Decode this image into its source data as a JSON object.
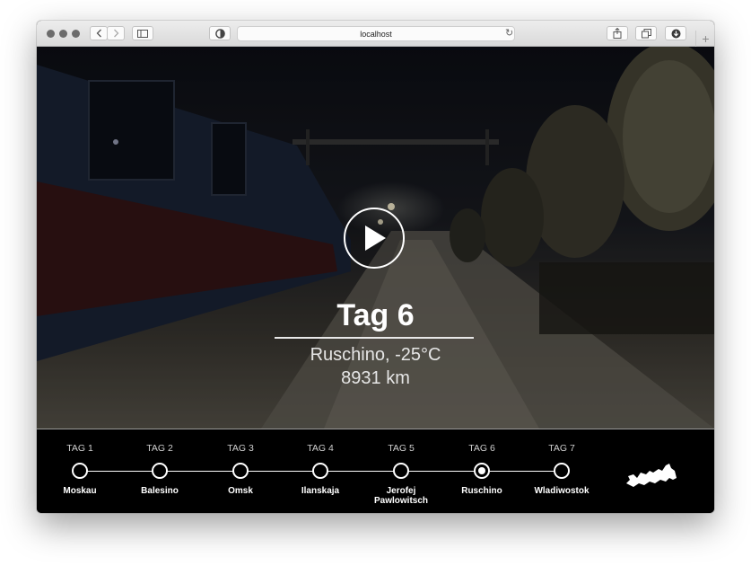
{
  "browser": {
    "url": "localhost"
  },
  "hero": {
    "title": "Tag 6",
    "location": "Ruschino, -25°C",
    "distance": "8931 km"
  },
  "timeline": {
    "active_index": 5,
    "stops": [
      {
        "tag": "TAG 1",
        "name": "Moskau"
      },
      {
        "tag": "TAG 2",
        "name": "Balesino"
      },
      {
        "tag": "TAG 3",
        "name": "Omsk"
      },
      {
        "tag": "TAG 4",
        "name": "Ilanskaja"
      },
      {
        "tag": "TAG 5",
        "name": "Jerofej Pawlowitsch"
      },
      {
        "tag": "TAG 6",
        "name": "Ruschino"
      },
      {
        "tag": "TAG 7",
        "name": "Wladiwostok"
      }
    ]
  }
}
